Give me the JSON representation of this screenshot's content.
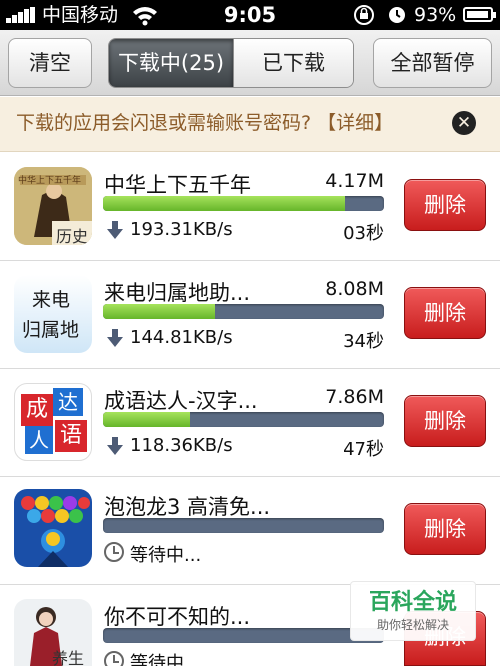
{
  "status_bar": {
    "carrier": "中国移动",
    "time": "9:05",
    "battery_text": "93%",
    "battery_level": 0.93,
    "icons": [
      "signal-icon",
      "wifi-icon",
      "rotation-lock-icon",
      "alarm-icon",
      "battery-icon"
    ]
  },
  "toolbar": {
    "clear_label": "清空",
    "tab_downloading": "下载中(25)",
    "tab_downloaded": "已下载",
    "pause_all_label": "全部暂停"
  },
  "notice": {
    "text": "下载的应用会闪退或需输账号密码? 【详细】",
    "close_icon": "close-icon"
  },
  "downloads": [
    {
      "name": "中华上下五千年",
      "size": "4.17M",
      "progress": 0.86,
      "speed": "193.31KB/s",
      "eta": "03秒",
      "status": "downloading",
      "icon_caption": "历史",
      "icon_title": "中华上下五千年"
    },
    {
      "name": "来电归属地助...",
      "size": "8.08M",
      "progress": 0.4,
      "speed": "144.81KB/s",
      "eta": "34秒",
      "status": "downloading",
      "icon_line1": "来电",
      "icon_line2": "归属地"
    },
    {
      "name": "成语达人-汉字...",
      "size": "7.86M",
      "progress": 0.31,
      "speed": "118.36KB/s",
      "eta": "47秒",
      "status": "downloading",
      "icon_chars": [
        "成",
        "达",
        "人",
        "语"
      ]
    },
    {
      "name": "泡泡龙3 高清免...",
      "size": "",
      "progress": 0,
      "status": "waiting",
      "waiting_text": "等待中..."
    },
    {
      "name": "你不可不知的...",
      "size": "",
      "progress": 0,
      "status": "waiting",
      "waiting_text": "等待中...",
      "icon_caption": "养生"
    }
  ],
  "delete_label": "删除",
  "watermark": {
    "title": "百科全说",
    "subtitle": "助你轻松解决"
  },
  "colors": {
    "progress_fill": "#7ccd3c",
    "progress_track": "#5a6a82",
    "delete_button": "#d42a2a",
    "active_tab": "#4f5559",
    "notice_bg": "#f7efe0",
    "notice_text": "#8c5c2a"
  }
}
